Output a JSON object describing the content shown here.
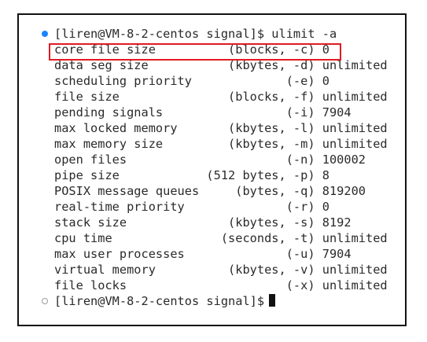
{
  "terminal": {
    "prompt": "[liren@VM-8-2-centos signal]$",
    "command_line": "[liren@VM-8-2-centos signal]$ ulimit -a",
    "output": [
      "core file size          (blocks, -c) 0",
      "data seg size           (kbytes, -d) unlimited",
      "scheduling priority             (-e) 0",
      "file size               (blocks, -f) unlimited",
      "pending signals                 (-i) 7904",
      "max locked memory       (kbytes, -l) unlimited",
      "max memory size         (kbytes, -m) unlimited",
      "open files                      (-n) 100002",
      "pipe size            (512 bytes, -p) 8",
      "POSIX message queues     (bytes, -q) 819200",
      "real-time priority              (-r) 0",
      "stack size              (kbytes, -s) 8192",
      "cpu time               (seconds, -t) unlimited",
      "max user processes              (-u) 7904",
      "virtual memory          (kbytes, -v) unlimited",
      "file locks                      (-x) unlimited"
    ],
    "highlighted_row": 0,
    "colors": {
      "text": "#2a2a2a",
      "highlight_border": "#e01b24",
      "active_marker": "#1a85ff",
      "frame_border": "#111111"
    }
  }
}
